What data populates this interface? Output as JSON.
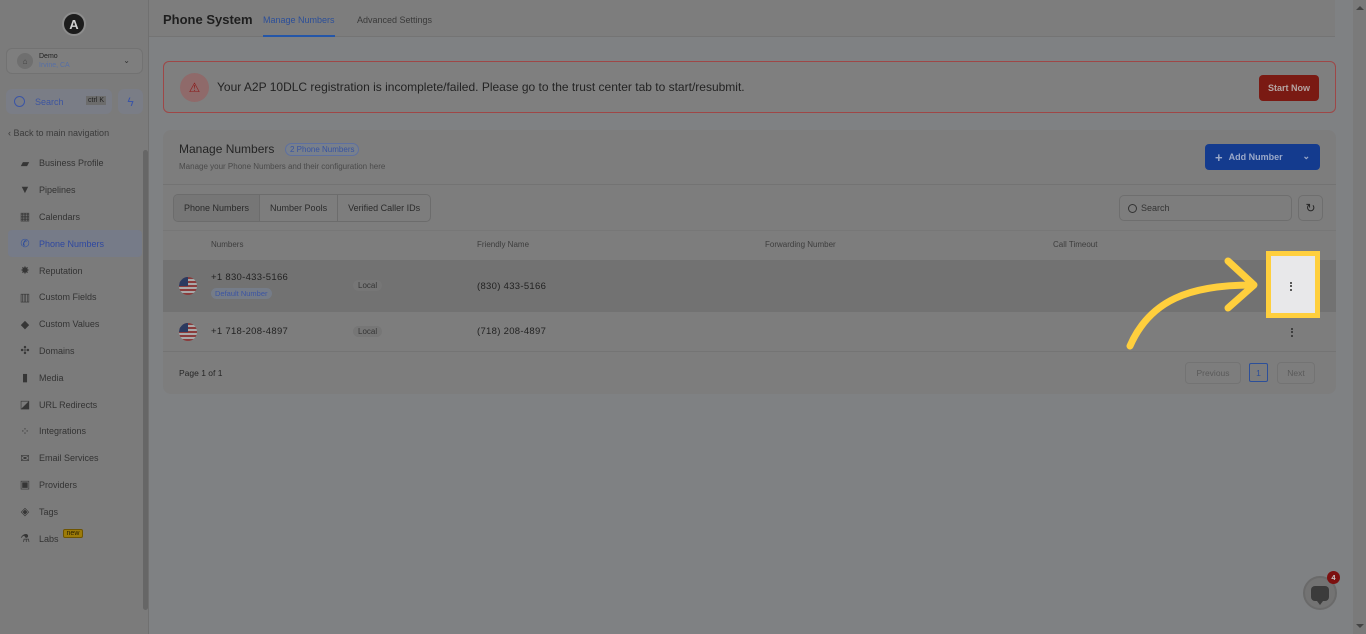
{
  "sidebar": {
    "logo_letter": "A",
    "location": {
      "name": "Demo",
      "sub": "Irvine, CA"
    },
    "search": {
      "label": "Search",
      "shortcut": "ctrl K"
    },
    "back_label": "Back to main navigation",
    "items": [
      {
        "label": "Business Profile",
        "icon": "briefcase-icon",
        "glyph": "▰",
        "active": false
      },
      {
        "label": "Pipelines",
        "icon": "funnel-icon",
        "glyph": "▼",
        "active": false
      },
      {
        "label": "Calendars",
        "icon": "calendar-icon",
        "glyph": "▦",
        "active": false
      },
      {
        "label": "Phone Numbers",
        "icon": "phone-icon",
        "glyph": "✆",
        "active": true
      },
      {
        "label": "Reputation",
        "icon": "star-badge-icon",
        "glyph": "✸",
        "active": false
      },
      {
        "label": "Custom Fields",
        "icon": "custom-fields-icon",
        "glyph": "▥",
        "active": false
      },
      {
        "label": "Custom Values",
        "icon": "diamond-icon",
        "glyph": "◆",
        "active": false
      },
      {
        "label": "Domains",
        "icon": "globe-icon",
        "glyph": "✣",
        "active": false
      },
      {
        "label": "Media",
        "icon": "media-icon",
        "glyph": "▮",
        "active": false
      },
      {
        "label": "URL Redirects",
        "icon": "redirect-icon",
        "glyph": "◪",
        "active": false
      },
      {
        "label": "Integrations",
        "icon": "integrations-icon",
        "glyph": "⁘",
        "active": false
      },
      {
        "label": "Email Services",
        "icon": "email-icon",
        "glyph": "✉",
        "active": false
      },
      {
        "label": "Providers",
        "icon": "clipboard-icon",
        "glyph": "▣",
        "active": false
      },
      {
        "label": "Tags",
        "icon": "tag-icon",
        "glyph": "◈",
        "active": false
      },
      {
        "label": "Labs",
        "icon": "flask-icon",
        "glyph": "⚗",
        "active": false,
        "badge": "new"
      }
    ]
  },
  "header": {
    "title": "Phone System",
    "tabs": [
      {
        "label": "Manage Numbers",
        "active": true
      },
      {
        "label": "Advanced Settings",
        "active": false
      }
    ]
  },
  "alert": {
    "message": "Your A2P 10DLC registration is incomplete/failed. Please go to the trust center tab to start/resubmit.",
    "button": "Start Now"
  },
  "card": {
    "title": "Manage Numbers",
    "count_badge": "2 Phone Numbers",
    "subtitle": "Manage your Phone Numbers and their configuration here",
    "add_button": "Add Number",
    "segments": [
      {
        "label": "Phone Numbers",
        "active": true
      },
      {
        "label": "Number Pools",
        "active": false
      },
      {
        "label": "Verified Caller IDs",
        "active": false
      }
    ],
    "search_placeholder": "Search",
    "columns": [
      "Numbers",
      "Friendly Name",
      "Forwarding Number",
      "Call Timeout"
    ],
    "rows": [
      {
        "number": "+1 830-433-5166",
        "tag": "Default Number",
        "type": "Local",
        "friendly_name": "(830) 433-5166",
        "forwarding": "",
        "timeout": ""
      },
      {
        "number": "+1 718-208-4897",
        "tag": "",
        "type": "Local",
        "friendly_name": "(718) 208-4897",
        "forwarding": "",
        "timeout": ""
      }
    ],
    "pagination": {
      "info": "Page 1 of 1",
      "previous": "Previous",
      "current": "1",
      "next": "Next"
    }
  },
  "chat_widget": {
    "count": "4"
  },
  "colors": {
    "accent": "#2456a8",
    "danger": "#7a1a13",
    "highlight": "#ffcf3d"
  }
}
